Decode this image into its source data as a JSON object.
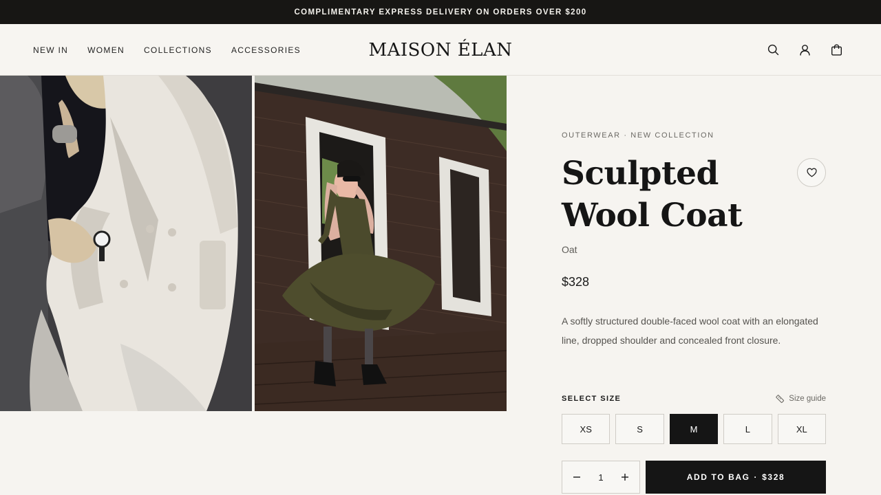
{
  "announcement": "COMPLIMENTARY EXPRESS DELIVERY ON ORDERS OVER $200",
  "nav": [
    "NEW IN",
    "WOMEN",
    "COLLECTIONS",
    "ACCESSORIES"
  ],
  "brand": "MAISON ÉLAN",
  "header_icons": [
    "search-icon",
    "account-icon",
    "bag-icon"
  ],
  "product": {
    "eyebrow": "OUTERWEAR · NEW COLLECTION",
    "title": "Sculpted Wool Coat",
    "color": "Oat",
    "price": "$328",
    "description": "A softly structured double-faced wool coat with an elongated line, dropped shoulder and concealed front closure.",
    "size_label": "SELECT SIZE",
    "size_guide": "Size guide",
    "sizes": [
      "XS",
      "S",
      "M",
      "L",
      "XL"
    ],
    "selected_size": "M",
    "quantity": "1",
    "add_label": "ADD TO BAG",
    "add_separator": "·",
    "add_price": "$328"
  },
  "colors": {
    "dark": "#151515",
    "background": "#f6f4f0",
    "announce_bg": "#171614"
  }
}
